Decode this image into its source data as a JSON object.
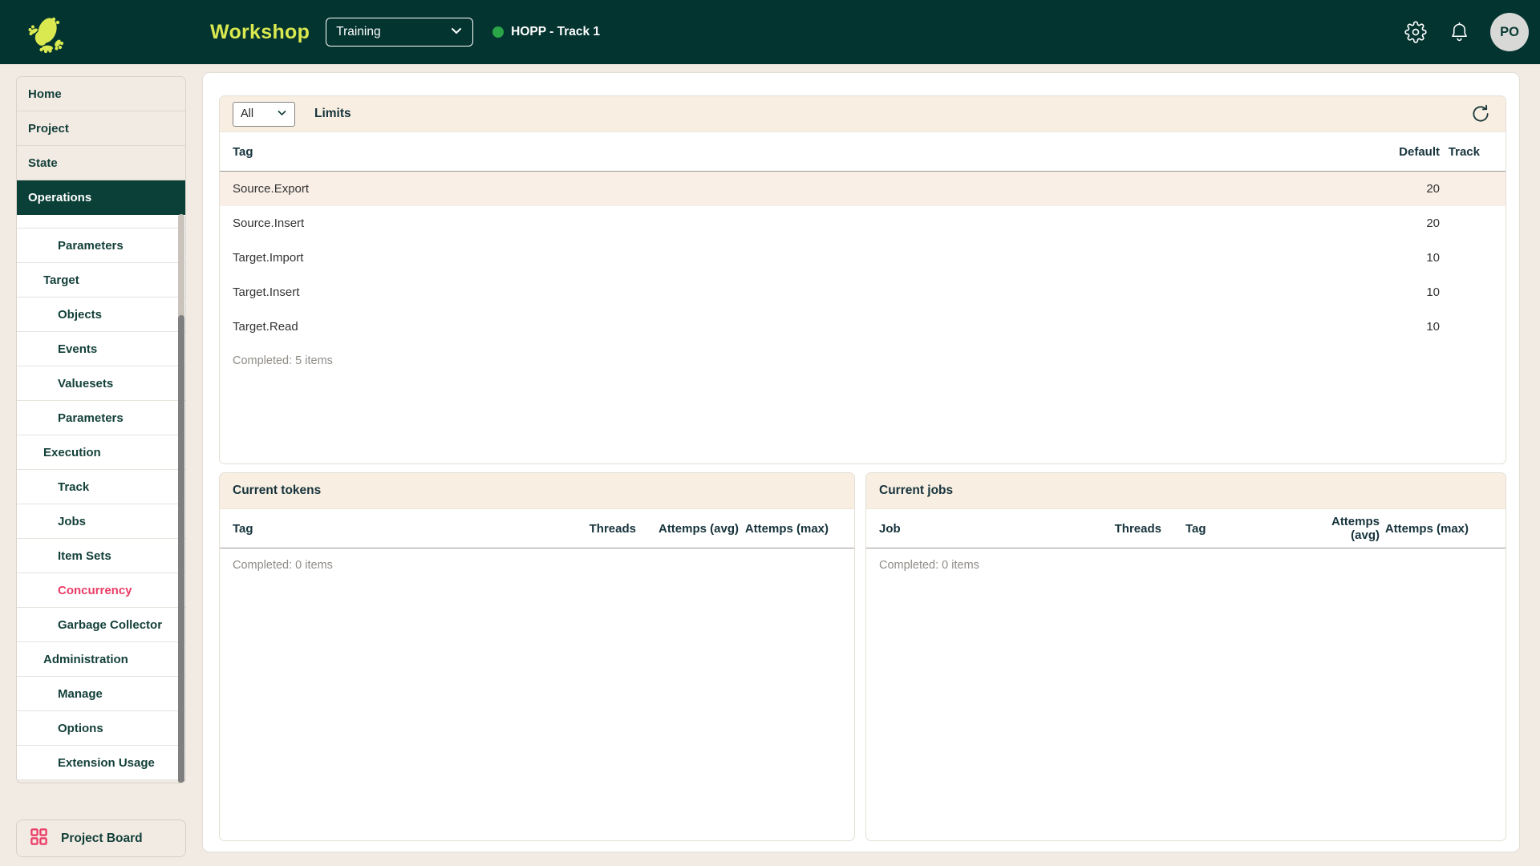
{
  "header": {
    "app_title": "Workshop",
    "environment_select": {
      "value": "Training"
    },
    "status": {
      "label": "HOPP - Track 1"
    },
    "avatar_initials": "PO"
  },
  "sidebar": {
    "items": [
      {
        "label": "Home"
      },
      {
        "label": "Project"
      },
      {
        "label": "State"
      },
      {
        "label": "Operations"
      },
      {
        "label": "Parameters"
      },
      {
        "label": "Target"
      },
      {
        "label": "Objects"
      },
      {
        "label": "Events"
      },
      {
        "label": "Valuesets"
      },
      {
        "label": "Parameters"
      },
      {
        "label": "Execution"
      },
      {
        "label": "Track"
      },
      {
        "label": "Jobs"
      },
      {
        "label": "Item Sets"
      },
      {
        "label": "Concurrency"
      },
      {
        "label": "Garbage Collector"
      },
      {
        "label": "Administration"
      },
      {
        "label": "Manage"
      },
      {
        "label": "Options"
      },
      {
        "label": "Extension Usage"
      }
    ],
    "project_board_label": "Project Board"
  },
  "limits": {
    "filter_value": "All",
    "title": "Limits",
    "columns": {
      "tag": "Tag",
      "default": "Default",
      "track": "Track"
    },
    "rows": [
      {
        "tag": "Source.Export",
        "default": "20",
        "track": ""
      },
      {
        "tag": "Source.Insert",
        "default": "20",
        "track": ""
      },
      {
        "tag": "Target.Import",
        "default": "10",
        "track": ""
      },
      {
        "tag": "Target.Insert",
        "default": "10",
        "track": ""
      },
      {
        "tag": "Target.Read",
        "default": "10",
        "track": ""
      }
    ],
    "footer": "Completed: 5 items"
  },
  "current_tokens": {
    "title": "Current tokens",
    "columns": [
      "Tag",
      "Threads",
      "Attemps (avg)",
      "Attemps (max)"
    ],
    "footer": "Completed: 0 items"
  },
  "current_jobs": {
    "title": "Current jobs",
    "columns": [
      "Job",
      "Threads",
      "Tag",
      "Attemps (avg)",
      "Attemps (max)"
    ],
    "footer": "Completed: 0 items"
  },
  "colors": {
    "header_green": "#043430",
    "accent_yellow": "#d9e94f",
    "status_green": "#2aa648",
    "concurrency_pink": "#ea3d66",
    "selected_nav_green": "#0a4038",
    "row_highlight": "#f9efe7"
  }
}
